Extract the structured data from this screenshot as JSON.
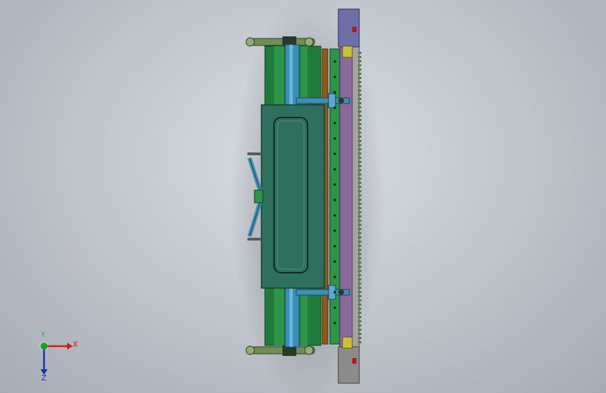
{
  "viewport": {
    "background_top": "#d9dde3",
    "background_bottom": "#a6acb5"
  },
  "triad": {
    "x_label": "X",
    "y_label": "Y",
    "z_label": "Z",
    "x_color": "#d11a1a",
    "y_color": "#18a018",
    "z_color": "#1c2fb0"
  },
  "model": {
    "icons": [
      "cad-model"
    ],
    "colors": {
      "frame_green": "#1e7b3a",
      "shaft_blue": "#3a8fb8",
      "panel_teal": "#2f6f5e",
      "rail_purple": "#8a6a9e",
      "rail_grey": "#8c8c8c",
      "bar_brown": "#8b5a1c",
      "bracket_cyan": "#3f8fb5",
      "tie_rod_green": "#6f8f56"
    }
  }
}
